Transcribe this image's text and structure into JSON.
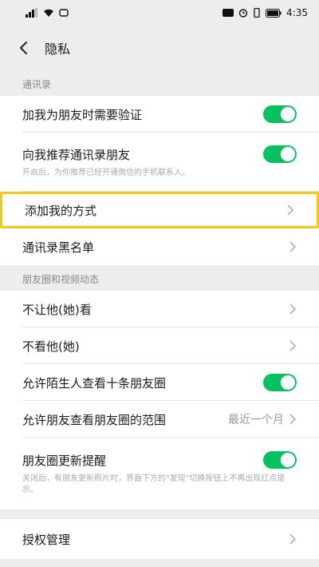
{
  "status_bar": {
    "time": "4:35"
  },
  "nav": {
    "title": "隐私"
  },
  "sections": {
    "contacts": {
      "header": "通讯录",
      "items": [
        {
          "label": "加我为朋友时需要验证",
          "toggle": true
        },
        {
          "label": "向我推荐通讯录朋友",
          "toggle": true,
          "hint": "开启后，为你推荐已经开通微信的手机联系人。"
        },
        {
          "label": "添加我的方式"
        },
        {
          "label": "通讯录黑名单"
        }
      ]
    },
    "moments": {
      "header": "朋友圈和视频动态",
      "items": [
        {
          "label": "不让他(她)看"
        },
        {
          "label": "不看他(她)"
        },
        {
          "label": "允许陌生人查看十条朋友圈",
          "toggle": true
        },
        {
          "label": "允许朋友查看朋友圈的范围",
          "value": "最近一个月"
        },
        {
          "label": "朋友圈更新提醒",
          "toggle": true,
          "hint": "关闭后，有朋友更新照片时，界面下方的\"发现\"切换按钮上不再出现红点提示。"
        }
      ]
    },
    "auth": {
      "items": [
        {
          "label": "授权管理"
        }
      ]
    }
  },
  "colors": {
    "toggle_on": "#07c160",
    "highlight": "#f5c518",
    "background": "#ededed"
  }
}
